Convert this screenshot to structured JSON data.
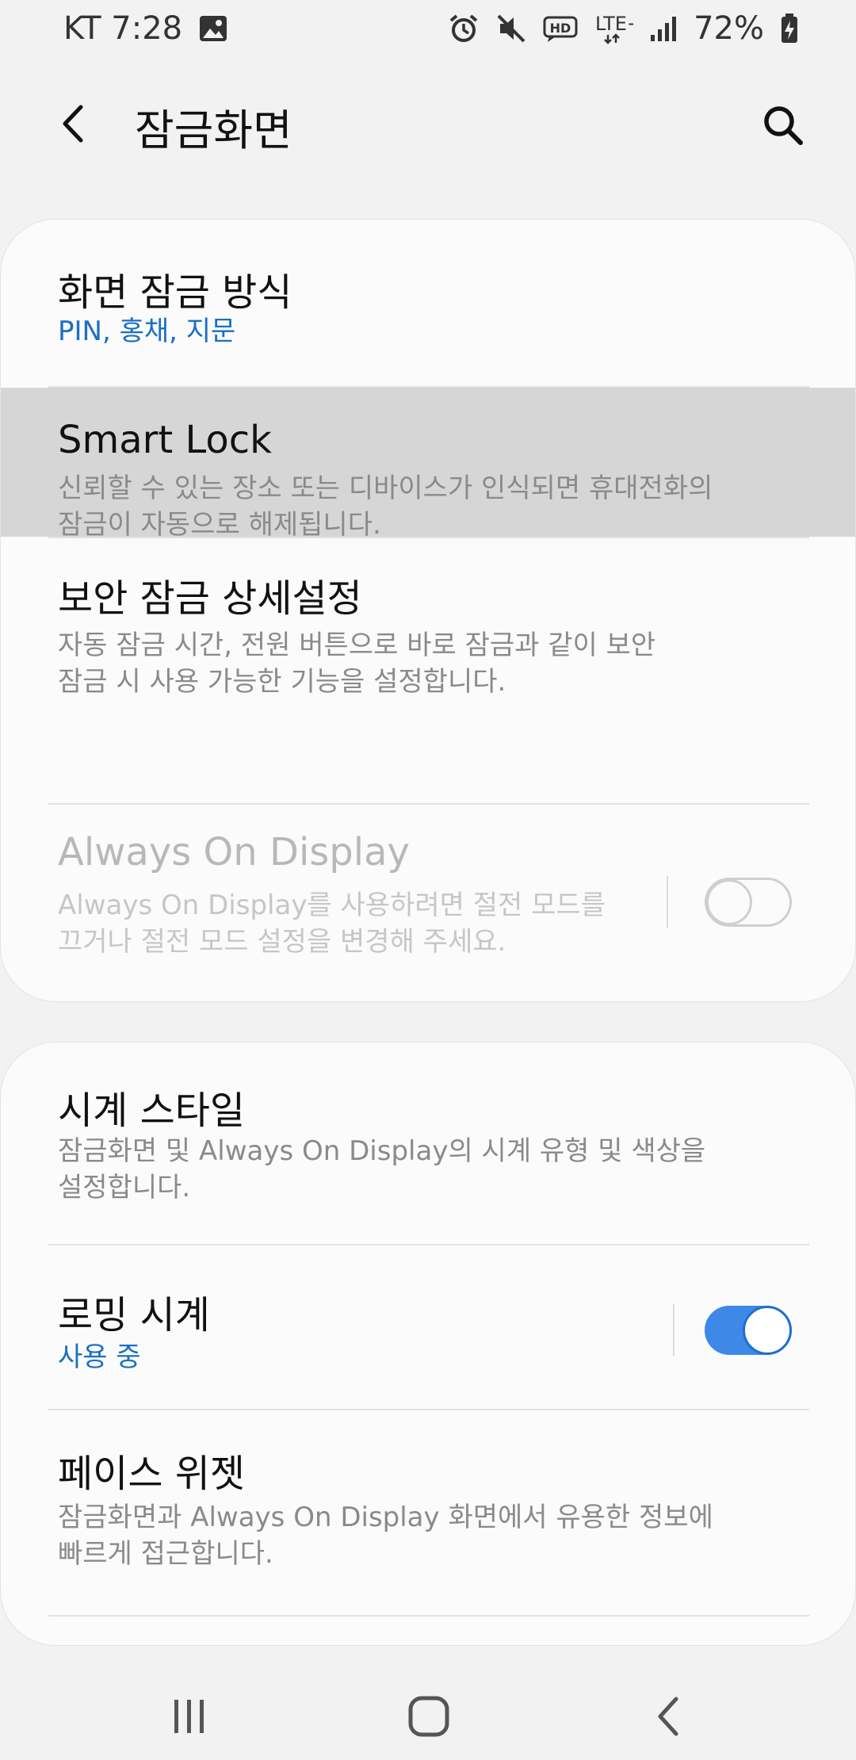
{
  "status_bar": {
    "carrier_time": "KT 7:28",
    "network": "LTE+",
    "battery": "72%",
    "icons": [
      "image-icon",
      "alarm-icon",
      "mute-icon",
      "hd-icon",
      "signal-icon",
      "battery-charging-icon"
    ]
  },
  "header": {
    "title": "잠금화면",
    "back_icon": "back-arrow-icon",
    "search_icon": "search-icon"
  },
  "section1": {
    "items": [
      {
        "title": "화면 잠금 방식",
        "subtitle": [
          "PIN, 홍채, 지문"
        ],
        "subtitle_color": "#1a6fc4"
      },
      {
        "title": "Smart Lock",
        "subtitle": [
          "신뢰할 수 있는 장소 또는 디바이스가 인식되면 휴대전화의",
          "잠금이 자동으로 해제됩니다."
        ],
        "pressed": true
      },
      {
        "title": "보안 잠금 상세설정",
        "subtitle": [
          "자동 잠금 시간, 전원 버튼으로 바로 잠금과 같이 보안",
          "잠금 시 사용 가능한 기능을 설정합니다."
        ]
      },
      {
        "title": "Always On Display",
        "subtitle": [
          "Always On Display를 사용하려면 절전 모드를",
          "끄거나 절전 모드 설정을 변경해 주세요."
        ],
        "enabled": false,
        "toggle_on": false
      }
    ]
  },
  "section2": {
    "items": [
      {
        "title": "시계 스타일",
        "subtitle": [
          "잠금화면 및 Always On Display의 시계 유형 및 색상을",
          "설정합니다."
        ]
      },
      {
        "title": "로밍 시계",
        "subtitle": [
          "사용 중"
        ],
        "subtitle_color": "#1a6fc4",
        "toggle_on": true
      },
      {
        "title": "페이스 위젯",
        "subtitle": [
          "잠금화면과 Always On Display 화면에서 유용한 정보에",
          "빠르게 접근합니다."
        ]
      }
    ]
  },
  "nav_bar": {
    "icons": [
      "recents-icon",
      "home-icon",
      "back-icon"
    ]
  },
  "colors": {
    "accent": "#1a6fc4",
    "toggle_on": "#3e88e8",
    "background": "#f2f2f2",
    "card": "#fbfbfb",
    "pressed": "#d6d6d6"
  }
}
